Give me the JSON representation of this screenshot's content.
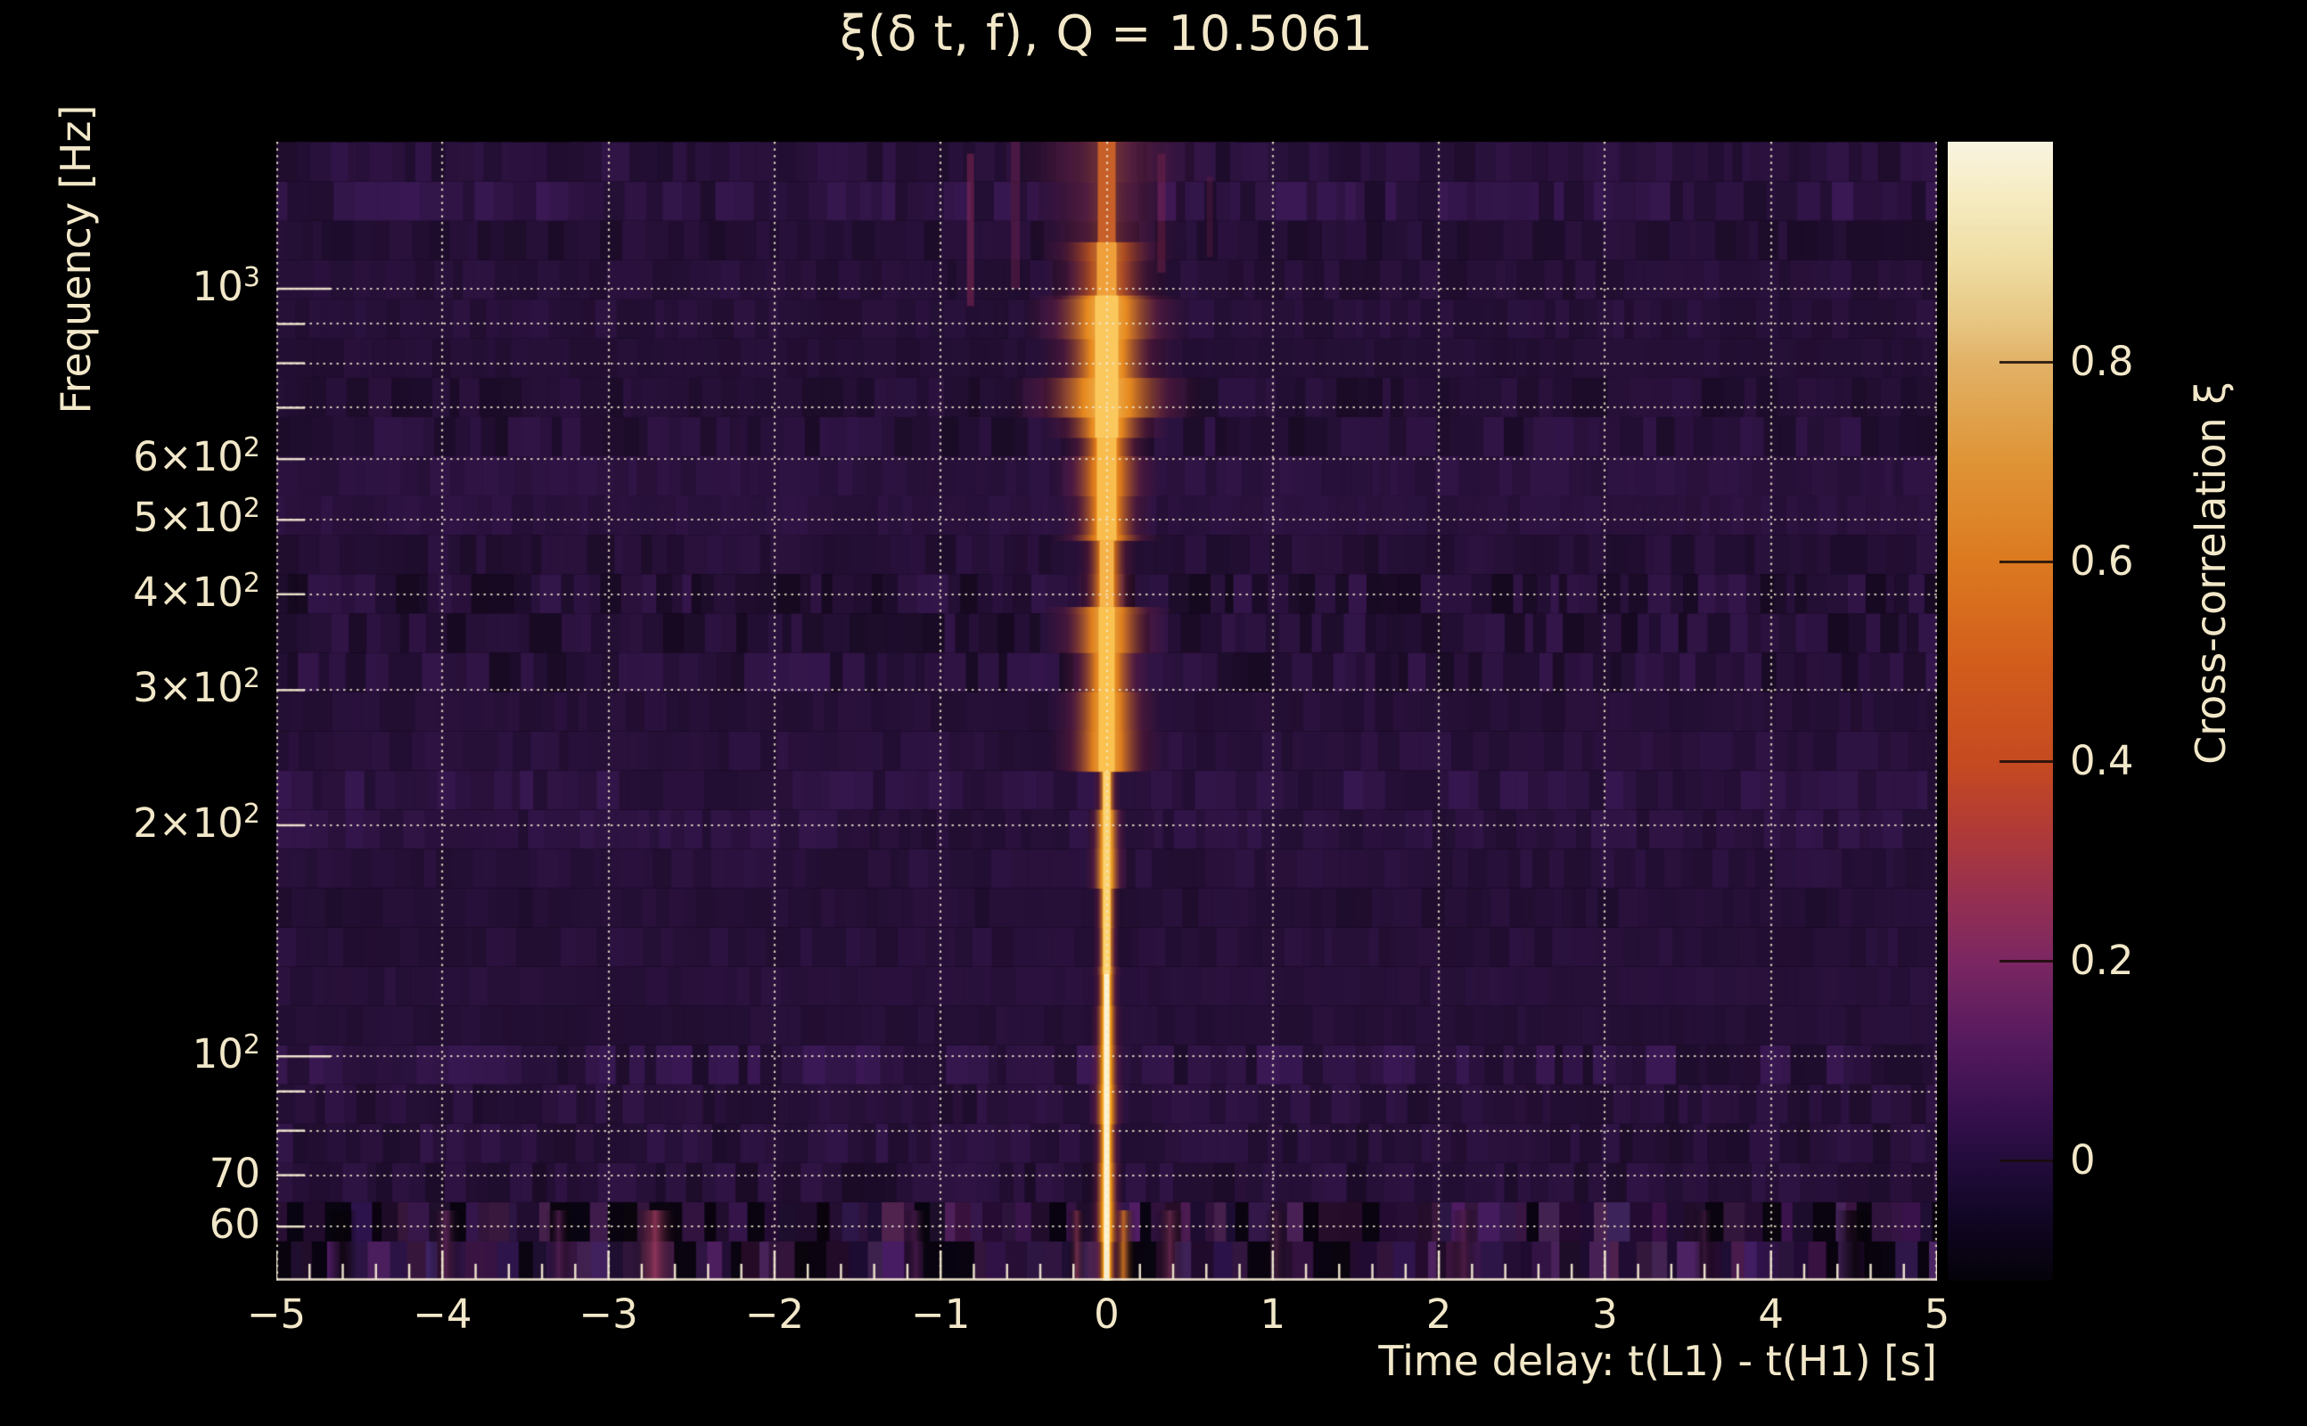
{
  "figure": {
    "title": "ξ(δ t, f), Q = 10.5061",
    "background_color": "#000000",
    "text_color": "#f2e8c9",
    "grid_color": "rgba(240,231,206,0.85)"
  },
  "chart_data": {
    "type": "heatmap",
    "title": "ξ(δ t, f), Q = 10.5061",
    "xlabel": "Time delay: t(L1) - t(H1) [s]",
    "ylabel": "Frequency [Hz]",
    "x_range": [
      -5,
      5
    ],
    "y_range_hz": [
      51,
      1555
    ],
    "y_scale": "log",
    "grid": true,
    "x_tick_values": [
      -5,
      -4,
      -3,
      -2,
      -1,
      0,
      1,
      2,
      3,
      4,
      5
    ],
    "x_tick_labels": [
      "−5",
      "−4",
      "−3",
      "−2",
      "−1",
      "0",
      "1",
      "2",
      "3",
      "4",
      "5"
    ],
    "x_minor_tick_step": 0.2,
    "y_ticks": [
      {
        "hz": 1000,
        "mantissa": "10",
        "exp": "3"
      },
      {
        "hz": 600,
        "mantissa": "6×10",
        "exp": "2"
      },
      {
        "hz": 500,
        "mantissa": "5×10",
        "exp": "2"
      },
      {
        "hz": 400,
        "mantissa": "4×10",
        "exp": "2"
      },
      {
        "hz": 300,
        "mantissa": "3×10",
        "exp": "2"
      },
      {
        "hz": 200,
        "mantissa": "2×10",
        "exp": "2"
      },
      {
        "hz": 100,
        "mantissa": "10",
        "exp": "2"
      },
      {
        "hz": 70,
        "mantissa": "70",
        "exp": ""
      },
      {
        "hz": 60,
        "mantissa": "60",
        "exp": ""
      }
    ],
    "y_gridlines_hz": [
      60,
      70,
      80,
      90,
      100,
      200,
      300,
      400,
      500,
      600,
      700,
      800,
      900,
      1000
    ],
    "colorbar": {
      "label": "Cross-correlation ξ",
      "tick_values": [
        0.8,
        0.6,
        0.4,
        0.2,
        0
      ],
      "tick_labels": [
        "0.8",
        "0.6",
        "0.4",
        "0.2",
        "0"
      ],
      "vmin": -0.12,
      "vmax": 1.02,
      "gradient_stops": [
        [
          0.0,
          "#f9f4e1"
        ],
        [
          0.045,
          "#f6ecc3"
        ],
        [
          0.105,
          "#efdda2"
        ],
        [
          0.16,
          "#e7c581"
        ],
        [
          0.193,
          "#e2b267"
        ],
        [
          0.28,
          "#df9436"
        ],
        [
          0.367,
          "#dc7a20"
        ],
        [
          0.46,
          "#d25c1c"
        ],
        [
          0.547,
          "#c54a21"
        ],
        [
          0.6,
          "#b23b35"
        ],
        [
          0.66,
          "#97304f"
        ],
        [
          0.718,
          "#7c2762"
        ],
        [
          0.79,
          "#551a5e"
        ],
        [
          0.85,
          "#38104e"
        ],
        [
          0.894,
          "#230c3c"
        ],
        [
          0.945,
          "#110624"
        ],
        [
          1.0,
          "#050209"
        ]
      ]
    },
    "heatmap": {
      "base_color": [
        38,
        16,
        55
      ],
      "ridge": {
        "delay_s": 0,
        "freq_span_hz": [
          51,
          1550
        ],
        "peak_cross_correlation": 1.0,
        "note": "bright vertical ridge at zero time delay; white-hot narrow core below ~130 Hz, broad orange plume 200–1150 Hz, faint smear above 1150 Hz"
      },
      "ridge_segments": [
        {
          "f_hi": 1555,
          "f_lo": 1150,
          "half": 46,
          "core_half": 10,
          "main": "#7a2a44",
          "core": "#c65f28",
          "alpha": 0.5
        },
        {
          "f_hi": 1150,
          "f_lo": 980,
          "half": 33,
          "core_half": 11,
          "main": "#c85a20",
          "core": "#f0a03a",
          "alpha": 0.85
        },
        {
          "f_hi": 980,
          "f_lo": 640,
          "half": 36,
          "core_half": 13,
          "main": "#ec8c1e",
          "core": "#fbc85e",
          "alpha": 0.97
        },
        {
          "f_hi": 640,
          "f_lo": 470,
          "half": 27,
          "core_half": 11,
          "main": "#e88218",
          "core": "#f9bd4e",
          "alpha": 0.95
        },
        {
          "f_hi": 470,
          "f_lo": 385,
          "half": 18,
          "core_half": 8,
          "main": "#e07a18",
          "core": "#f6b34a",
          "alpha": 0.92
        },
        {
          "f_hi": 385,
          "f_lo": 235,
          "half": 24,
          "core_half": 9,
          "main": "#e8851c",
          "core": "#fbc24f",
          "alpha": 0.95
        },
        {
          "f_hi": 235,
          "f_lo": 128,
          "half": 8,
          "core_half": 4,
          "main": "#f29b20",
          "core": "#fcd36e",
          "alpha": 0.96
        },
        {
          "f_hi": 128,
          "f_lo": 51,
          "half": 7,
          "core_half": 3,
          "main": "#f59c14",
          "core": "#fdf4d2",
          "alpha": 1.0
        }
      ],
      "side_streaks": [
        {
          "t": -0.82,
          "w": 8,
          "f_hi": 1500,
          "f_lo": 950,
          "color": "rgba(154,45,92,0.45)"
        },
        {
          "t": -0.55,
          "w": 10,
          "f_hi": 1555,
          "f_lo": 1000,
          "color": "rgba(120,35,80,0.40)"
        },
        {
          "t": 0.33,
          "w": 9,
          "f_hi": 1500,
          "f_lo": 1050,
          "color": "rgba(140,40,85,0.38)"
        },
        {
          "t": 0.62,
          "w": 7,
          "f_hi": 1400,
          "f_lo": 1100,
          "color": "rgba(110,30,70,0.32)"
        }
      ],
      "noise_band_hz": [
        51,
        63
      ],
      "noise_blotches": [
        {
          "t": -2.72,
          "w": 26,
          "color": "rgba(147,54,90,0.9)"
        },
        {
          "t": -3.98,
          "w": 18,
          "color": "rgba(95,38,88,0.8)"
        },
        {
          "t": -3.3,
          "w": 14,
          "color": "rgba(84,32,81,0.8)"
        },
        {
          "t": -1.15,
          "w": 14,
          "color": "rgba(78,30,78,0.7)"
        },
        {
          "t": -0.18,
          "w": 10,
          "color": "rgba(126,48,70,0.8)"
        },
        {
          "t": 0.1,
          "w": 14,
          "color": "rgba(224,122,32,0.85)"
        },
        {
          "t": 0.38,
          "w": 16,
          "color": "rgba(108,42,80,0.8)"
        },
        {
          "t": 1.02,
          "w": 12,
          "color": "rgba(73,32,63,0.7)"
        },
        {
          "t": 2.15,
          "w": 14,
          "color": "rgba(82,31,74,0.75)"
        },
        {
          "t": 3.6,
          "w": 12,
          "color": "rgba(63,26,60,0.7)"
        },
        {
          "t": 4.5,
          "w": 20,
          "color": "rgba(12,5,12,0.85)"
        },
        {
          "t": -4.6,
          "w": 16,
          "color": "rgba(10,4,10,0.8)"
        }
      ],
      "light_bands_hz": [
        [
          490,
          630
        ],
        [
          195,
          255
        ],
        [
          78,
          102
        ],
        [
          1250,
          1555
        ]
      ]
    }
  }
}
